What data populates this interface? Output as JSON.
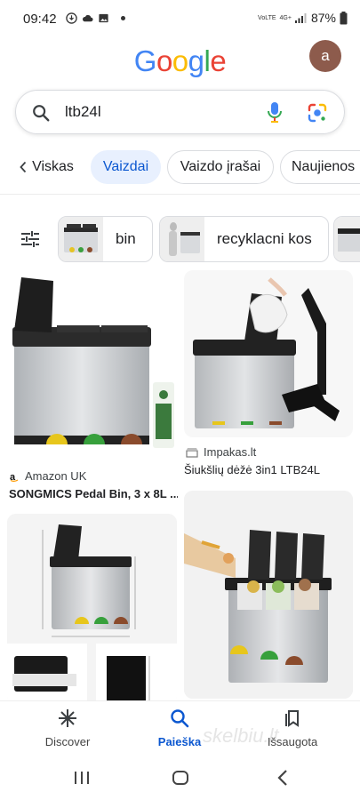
{
  "status_bar": {
    "time": "09:42",
    "network": "4G+",
    "volte": "VoLTE",
    "battery": "87%"
  },
  "header": {
    "logo_letters": [
      {
        "char": "G",
        "color": "#4285F4"
      },
      {
        "char": "o",
        "color": "#EA4335"
      },
      {
        "char": "o",
        "color": "#FBBC05"
      },
      {
        "char": "g",
        "color": "#4285F4"
      },
      {
        "char": "l",
        "color": "#34A853"
      },
      {
        "char": "e",
        "color": "#EA4335"
      }
    ],
    "avatar_letter": "a"
  },
  "search": {
    "query": "ltb24l"
  },
  "tabs": [
    {
      "label": "Viskas",
      "active": false
    },
    {
      "label": "Vaizdai",
      "active": true
    },
    {
      "label": "Vaizdo įrašai",
      "active": false
    },
    {
      "label": "Naujienos",
      "active": false
    }
  ],
  "chips": [
    {
      "label": "bin"
    },
    {
      "label": "recyklacni kos"
    }
  ],
  "results": [
    {
      "source": "Amazon UK",
      "title": "SONGMICS Pedal Bin, 3 x 8L ..."
    },
    {
      "source": "Impakas.lt",
      "title": "Šiukšlių dėžė 3in1 LTB24L"
    },
    {
      "source": "",
      "title": ""
    },
    {
      "source": "",
      "title": ""
    }
  ],
  "bottom_nav": [
    {
      "label": "Discover",
      "icon": "asterisk-icon",
      "active": false
    },
    {
      "label": "Paieška",
      "icon": "search-icon",
      "active": true
    },
    {
      "label": "Išsaugota",
      "icon": "bookmark-icon",
      "active": false
    }
  ],
  "watermark": "skelbiu.lt",
  "colors": {
    "accent": "#0b57d0",
    "active_tab_bg": "#e8f0fe",
    "avatar_bg": "#8d5b4c"
  }
}
